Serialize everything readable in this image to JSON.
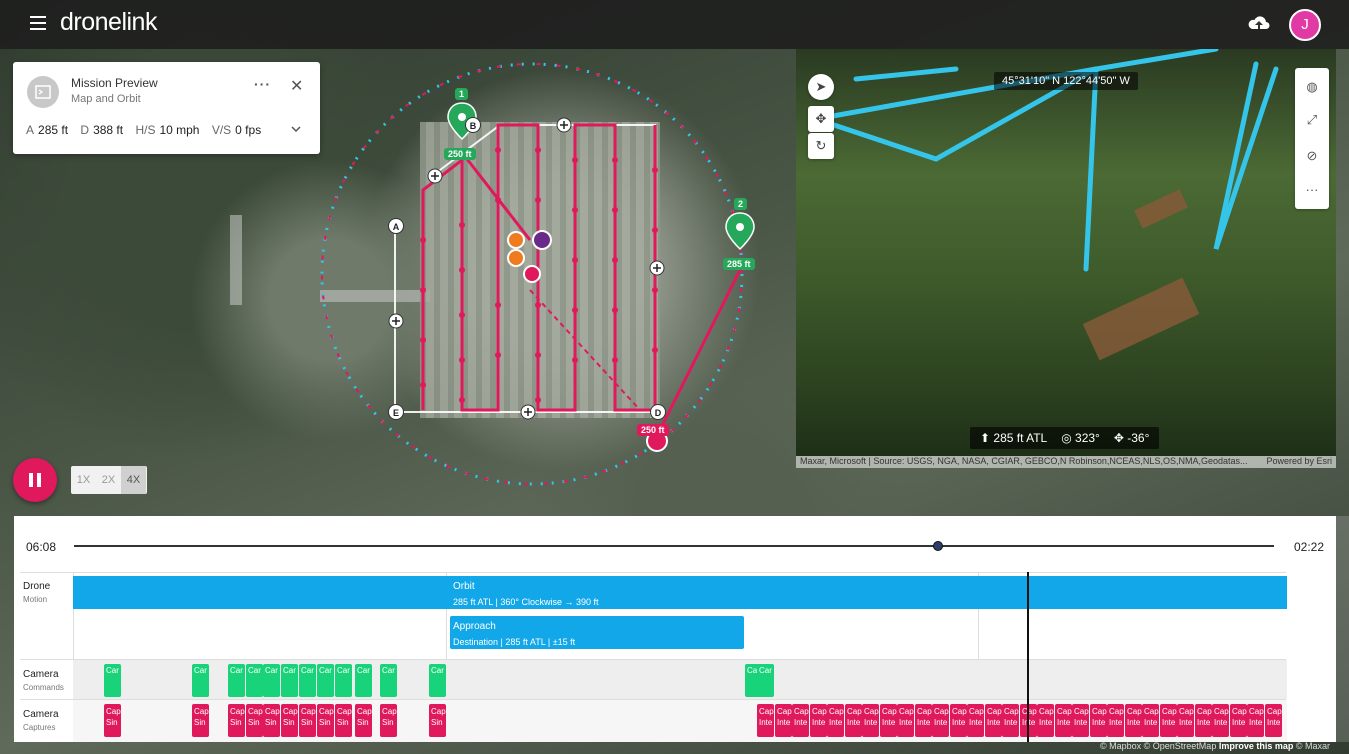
{
  "app": {
    "logo": "dronelink",
    "avatar_initial": "J"
  },
  "mission": {
    "title": "Mission Preview",
    "subtitle": "Map and Orbit",
    "stats": [
      {
        "key": "A",
        "value": "285 ft"
      },
      {
        "key": "D",
        "value": "388 ft"
      },
      {
        "key": "H/S",
        "value": "10 mph"
      },
      {
        "key": "V/S",
        "value": "0 fps"
      }
    ]
  },
  "map": {
    "pins": {
      "p1_num": "1",
      "p1_alt": "250 ft",
      "p2_num": "2",
      "p2_alt": "285 ft",
      "p3_alt": "250 ft"
    },
    "waypoints": [
      "A",
      "B",
      "D",
      "E"
    ],
    "colors": {
      "path": "#e0195c",
      "orbit": "#36c5ea",
      "pin": "#25a85a"
    }
  },
  "view3d": {
    "coords": "45°31'10\" N 122°44'50\" W",
    "status": {
      "altitude": "285 ft ATL",
      "heading": "323°",
      "gimbal": "-36°"
    },
    "attribution": "Maxar, Microsoft | Source: USGS, NGA, NASA, CGIAR, GEBCO,N Robinson,NCEAS,NLS,OS,NMA,Geodatas...",
    "powered_by": "Powered by Esri"
  },
  "playback": {
    "speeds": [
      "1X",
      "2X",
      "4X"
    ],
    "active_speed": "4X"
  },
  "timeline": {
    "start_time": "06:08",
    "end_time": "02:22",
    "progress": 0.72,
    "lanes": [
      {
        "name": "Drone",
        "sub": "Motion"
      },
      {
        "name": "Camera",
        "sub": "Commands"
      },
      {
        "name": "Camera",
        "sub": "Captures"
      }
    ],
    "orbit": {
      "title": "Orbit",
      "detail": "285 ft ATL | 360° Clockwise → 390 ft"
    },
    "approach": {
      "title": "Approach",
      "detail": "Destination | 285 ft ATL | ±15 ft"
    },
    "cmd_label": "Car",
    "cap_label_a": "Cap",
    "cap_label_b": "Sin",
    "cap_label_c": "Inte"
  },
  "map_attribution": {
    "text": "© Mapbox © OpenStreetMap ",
    "improve": "Improve this map",
    "maxar": " © Maxar"
  }
}
